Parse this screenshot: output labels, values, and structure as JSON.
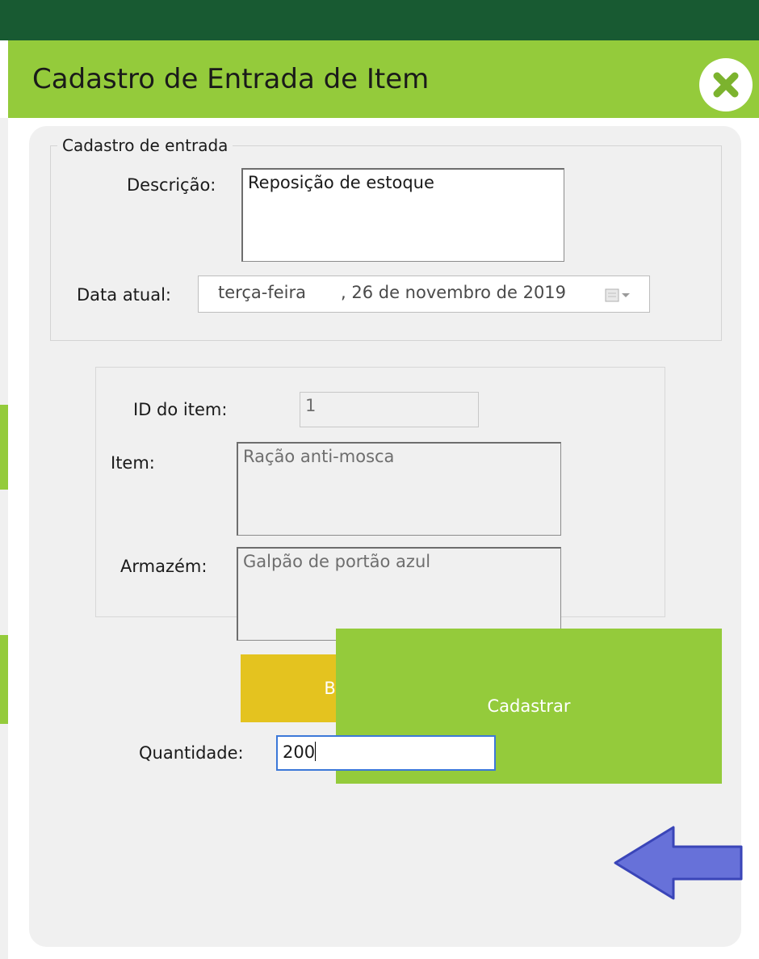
{
  "window": {
    "title": "Cadastro de Entrada de Item"
  },
  "form": {
    "group_label": "Cadastro de entrada",
    "descricao_label": "Descrição:",
    "descricao_value": "Reposição de estoque",
    "data_label": "Data atual:",
    "data_weekday": "terça-feira",
    "data_rest": ", 26 de novembro de 2019",
    "id_label": "ID do item:",
    "id_value": "1",
    "item_label": "Item:",
    "item_value": "Ração anti-mosca",
    "armazem_label": "Armazém:",
    "armazem_value": "Galpão de portão azul",
    "buscar_label": "Buscar Estoque",
    "quantidade_label": "Quantidade:",
    "quantidade_value": "200",
    "cadastrar_label": "Cadastrar"
  },
  "colors": {
    "top_bar": "#185a32",
    "title_bar": "#94cb3b",
    "buscar_button": "#e4c31f",
    "cadastrar_button": "#94cb3b",
    "arrow": "#5863d6"
  }
}
